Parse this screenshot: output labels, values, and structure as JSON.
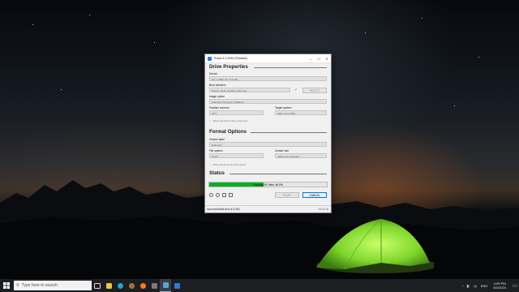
{
  "window": {
    "title": "Rufus 4.3.2090 (Portable)",
    "minimize": "—",
    "maximize": "☐",
    "close": "✕"
  },
  "drive_properties": {
    "heading": "Drive Properties",
    "device_label": "Device",
    "device_value": "NO_LABEL (D:) [16 GB]",
    "boot_label": "Boot selection",
    "boot_value": "Win10_22H2_English_x64v1.iso",
    "select_button": "SELECT",
    "image_option_label": "Image option",
    "image_option_value": "Standard Windows installation",
    "partition_label": "Partition scheme",
    "partition_value": "GPT",
    "target_label": "Target system",
    "target_value": "UEFI (non CSM)",
    "advanced_toggle": "Show advanced drive properties"
  },
  "format_options": {
    "heading": "Format Options",
    "volume_label": "Volume label",
    "volume_value": "ESD-ISO",
    "fs_label": "File system",
    "fs_value": "NTFS",
    "cluster_label": "Cluster size",
    "cluster_value": "4096 bytes (Default)",
    "advanced_toggle": "Show advanced format options"
  },
  "status": {
    "heading": "Status",
    "progress_text": "Copying ISO files: 46.0%",
    "progress_fraction": 0.46,
    "start_button": "START",
    "cancel_button": "CANCEL",
    "statusbar_text": "\\sources\\install.wim (4.8 GB)",
    "elapsed": "00:01:08"
  },
  "taskbar": {
    "search_placeholder": "Type here to search",
    "time": "4:09 PM",
    "date": "8/2/2024",
    "language": "ENG"
  },
  "colors": {
    "progress_green": "#06b025",
    "cancel_accent": "#0078d7",
    "tent_green": "#8fe63a"
  }
}
